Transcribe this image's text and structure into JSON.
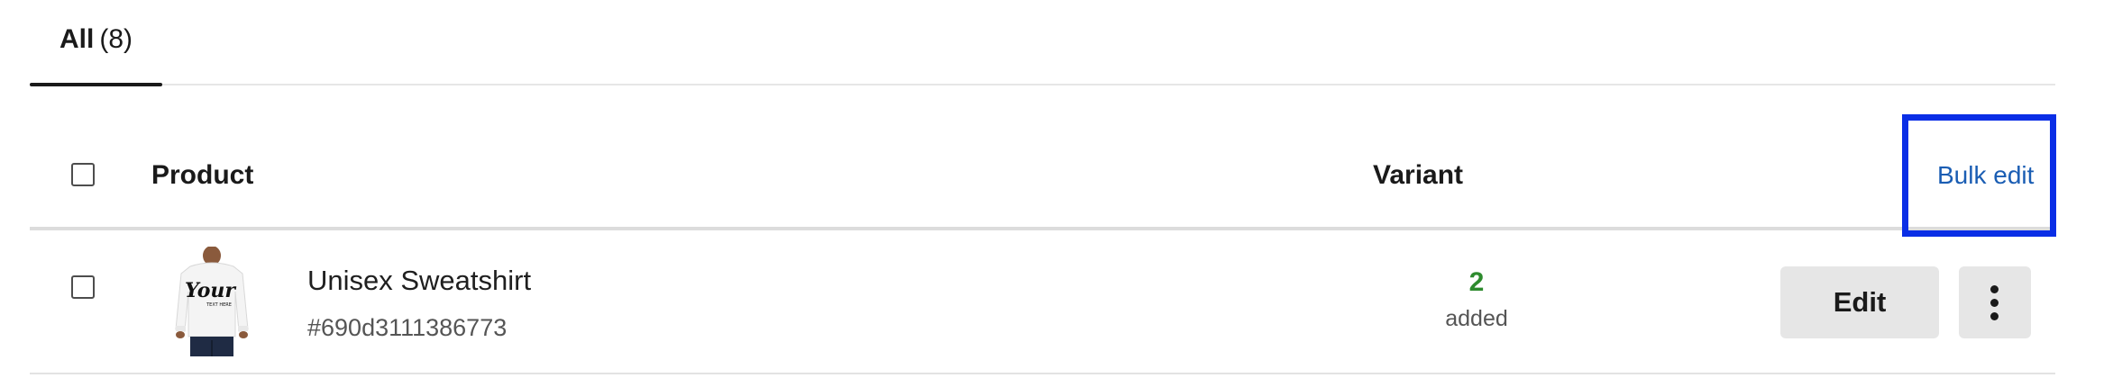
{
  "tabs": [
    {
      "label": "All",
      "count": "(8)",
      "active": true
    }
  ],
  "table": {
    "headers": {
      "product": "Product",
      "variant": "Variant",
      "bulk_edit": "Bulk edit"
    },
    "rows": [
      {
        "name": "Unisex Sweatshirt",
        "id": "#690d3111386773",
        "variant_count": "2",
        "variant_status": "added",
        "edit_label": "Edit",
        "thumbnail_text": "Your",
        "thumbnail_subtext": "TEXT HERE"
      }
    ]
  },
  "colors": {
    "variant_count": "#2e8b2e",
    "link": "#1a5db3",
    "highlight_frame": "#0a2ee6",
    "button_bg": "#e6e6e6"
  },
  "icons": {
    "more": "vertical-ellipsis-icon",
    "checkbox": "checkbox-unchecked"
  }
}
